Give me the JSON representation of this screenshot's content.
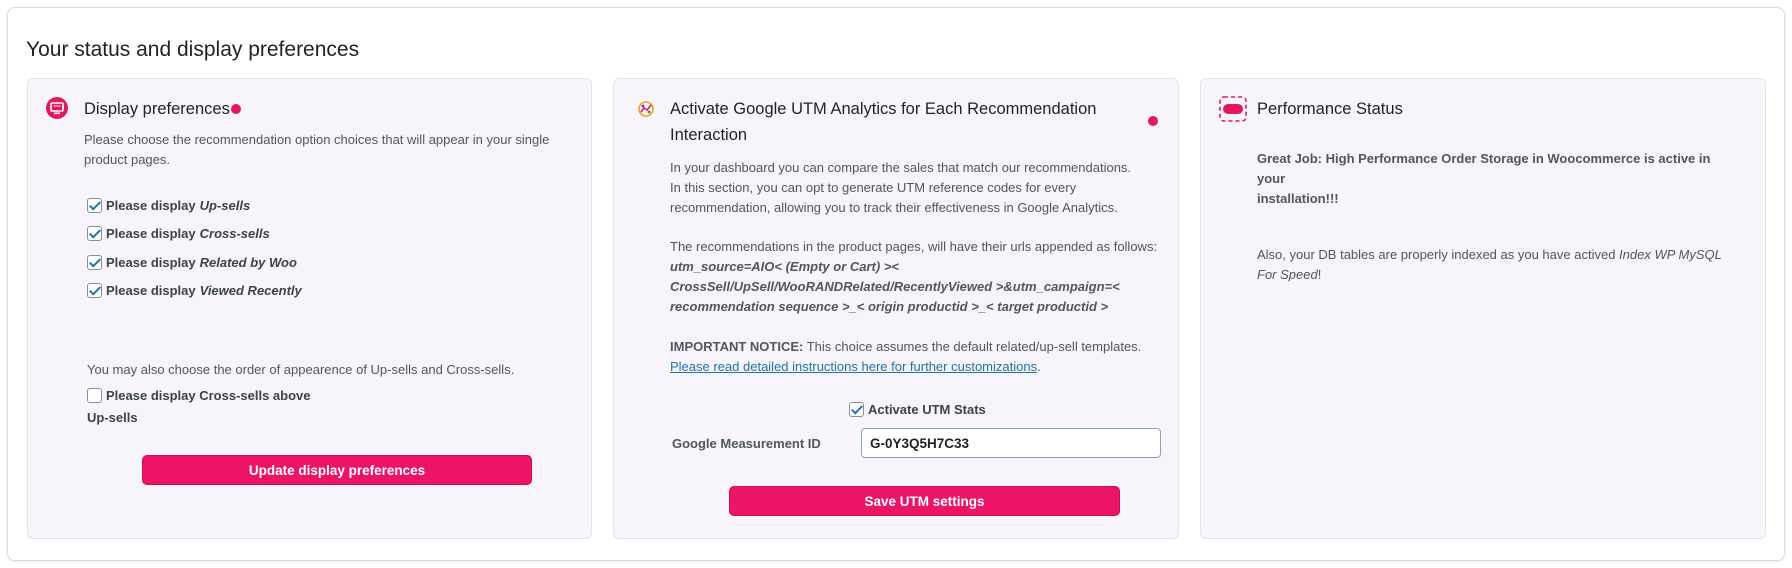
{
  "page_title": "Your status and display preferences",
  "colors": {
    "accent": "#ec1466",
    "card_bg": "#f7f4fb",
    "link": "#2271b1"
  },
  "display_card": {
    "title": "Display preferences",
    "icon": "display-monitor-icon",
    "description": "Please choose the recommendation option choices that will appear in your single product pages.",
    "checkbox_prefix": "Please display",
    "options": [
      {
        "label": "Up-sells",
        "checked": true
      },
      {
        "label": "Cross-sells",
        "checked": true
      },
      {
        "label": "Related by Woo",
        "checked": true
      },
      {
        "label": "Viewed Recently",
        "checked": true
      }
    ],
    "order_note": "You may also choose the order of appearence of Up-sells and Cross-sells.",
    "order_checkbox": {
      "label_line1": "Please display Cross-sells above",
      "label_line2": "Up-sells",
      "checked": false
    },
    "button_label": "Update display preferences"
  },
  "utm_card": {
    "title_line1": "Activate Google UTM Analytics for Each Recommendation",
    "title_line2": "Interaction",
    "icon": "analytics-chart-icon",
    "intro_lines": [
      "In your dashboard you can compare the sales that match our recommendations.",
      "In this section, you can opt to generate UTM reference codes for every",
      "recommendation, allowing you to track their effectiveness in Google Analytics."
    ],
    "url_intro": "The recommendations in the product pages, will have their urls appended as follows:",
    "url_lines": [
      "utm_source=AIO< (Empty or Cart) ><",
      "CrossSell/UpSell/WooRANDRelated/RecentlyViewed >&utm_campaign=<",
      "recommendation sequence >_< origin productid >_< target productid >"
    ],
    "notice_label": "IMPORTANT NOTICE:",
    "notice_text": " This choice assumes the default related/up-sell templates.",
    "instructions_link": "Please read detailed instructions here for further customizations",
    "instructions_suffix": ".",
    "activate_label": "Activate UTM Stats",
    "activate_checked": true,
    "measurement_label": "Google Measurement ID",
    "measurement_value": "G-0Y3Q5H7C33",
    "button_label": "Save UTM settings"
  },
  "performance_card": {
    "title": "Performance Status",
    "icon": "toggle-status-icon",
    "line1": "Great Job: High Performance Order Storage in Woocommerce is active in your",
    "line2": "installation!!!",
    "db_line1_prefix": "Also, your DB tables are properly indexed as you have actived ",
    "db_line1_em": "Index WP MySQL",
    "db_line2_em": "For Speed",
    "db_line2_suffix": "!"
  }
}
